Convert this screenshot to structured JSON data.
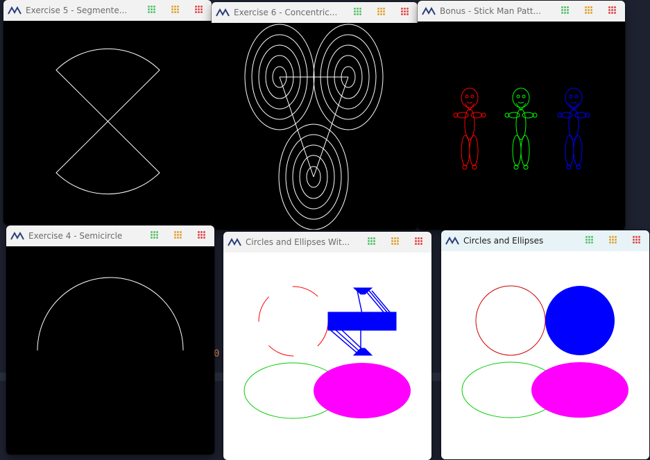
{
  "windows": {
    "ex5": {
      "title": "Exercise 5 - Segmente..."
    },
    "ex6": {
      "title": "Exercise 6 - Concentric..."
    },
    "bonus": {
      "title": "Bonus - Stick Man Patt..."
    },
    "ex4": {
      "title": "Exercise 4 - Semicircle"
    },
    "ce_with": {
      "title": "Circles and Ellipses Wit..."
    },
    "ce": {
      "title": "Circles and Ellipses"
    }
  },
  "window_controls": {
    "minimize_color": "#59c26d",
    "maximize_color": "#e0a43a",
    "close_color": "#e04b4b"
  },
  "colors": {
    "black_canvas": "#000000",
    "white_canvas": "#ffffff",
    "red": "#ff0000",
    "green": "#00ff00",
    "blue": "#0000ff",
    "magenta": "#ff00ff"
  },
  "background_code": {
    "fragments": [
      "0"
    ]
  }
}
